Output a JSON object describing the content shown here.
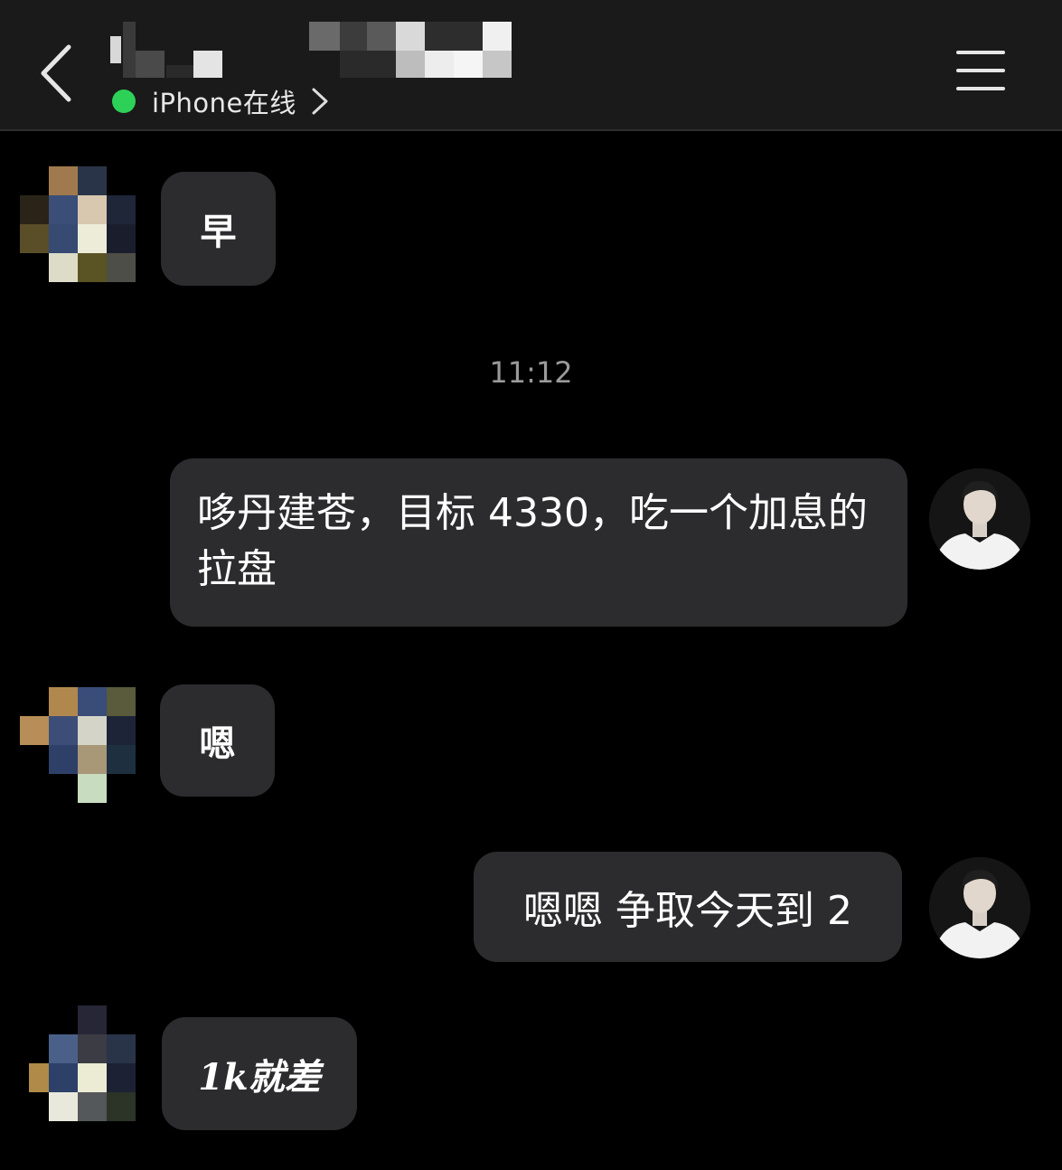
{
  "header": {
    "back_icon": "chevron-left-icon",
    "status_text": "iPhone在线",
    "status_color": "#2ed158",
    "menu_icon": "hamburger-menu-icon"
  },
  "timestamp": "11:12",
  "messages": [
    {
      "sender": "contact",
      "text": "早"
    },
    {
      "sender": "me",
      "text": "哆丹建苍，目标 4330，吃一个加息的拉盘"
    },
    {
      "sender": "contact",
      "text": "嗯"
    },
    {
      "sender": "me",
      "text": "嗯嗯 争取今天到 2"
    },
    {
      "sender": "contact",
      "text": "1k就差"
    }
  ],
  "colors": {
    "background": "#000000",
    "header_bg": "#1a1a1a",
    "bubble_bg": "#2c2c2e",
    "text": "#ffffff",
    "timestamp": "#9a9a9a"
  }
}
